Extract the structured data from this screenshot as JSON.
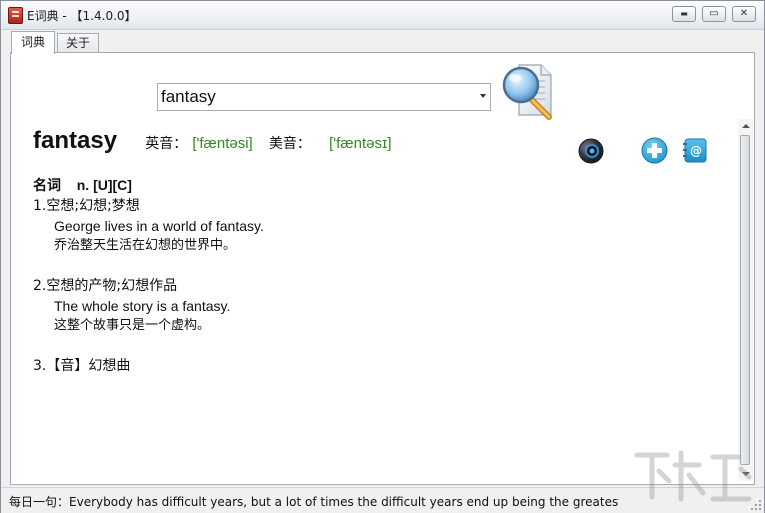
{
  "window": {
    "title": "E词典 - 【1.4.0.0】",
    "controls": {
      "minimize": "▬",
      "maximize": "▭",
      "close": "✕"
    }
  },
  "tabs": [
    {
      "label": "词典",
      "active": true
    },
    {
      "label": "关于",
      "active": false
    }
  ],
  "search": {
    "value": "fantasy"
  },
  "entry": {
    "headword": "fantasy",
    "uk_label": "英音：",
    "uk_phonetic": "['fæntəsi]",
    "us_label": "美音：",
    "us_phonetic": "['fæntəsɪ]",
    "pos": "名词",
    "pos_detail": "n. [U][C]",
    "senses": [
      {
        "title": "1.空想;幻想;梦想",
        "example_en": "George lives in a world of fantasy.",
        "example_cn": "乔治整天生活在幻想的世界中。"
      },
      {
        "title": "2.空想的产物;幻想作品",
        "example_en": "The whole story is a fantasy.",
        "example_cn": "这整个故事只是一个虚构。"
      },
      {
        "title": "3.【音】幻想曲"
      }
    ]
  },
  "icons": {
    "search": "magnifier-document-icon",
    "speaker": "speaker-icon",
    "add": "plus-circle-icon",
    "contact": "address-book-icon"
  },
  "status": {
    "label": "每日一句：",
    "sentence": "Everybody has difficult years, but a lot of times the difficult years end up being the greatest..."
  },
  "colors": {
    "phonetic": "#2e8b1e",
    "add_icon": "#2aa3d8",
    "contact_icon": "#27a3d6"
  }
}
